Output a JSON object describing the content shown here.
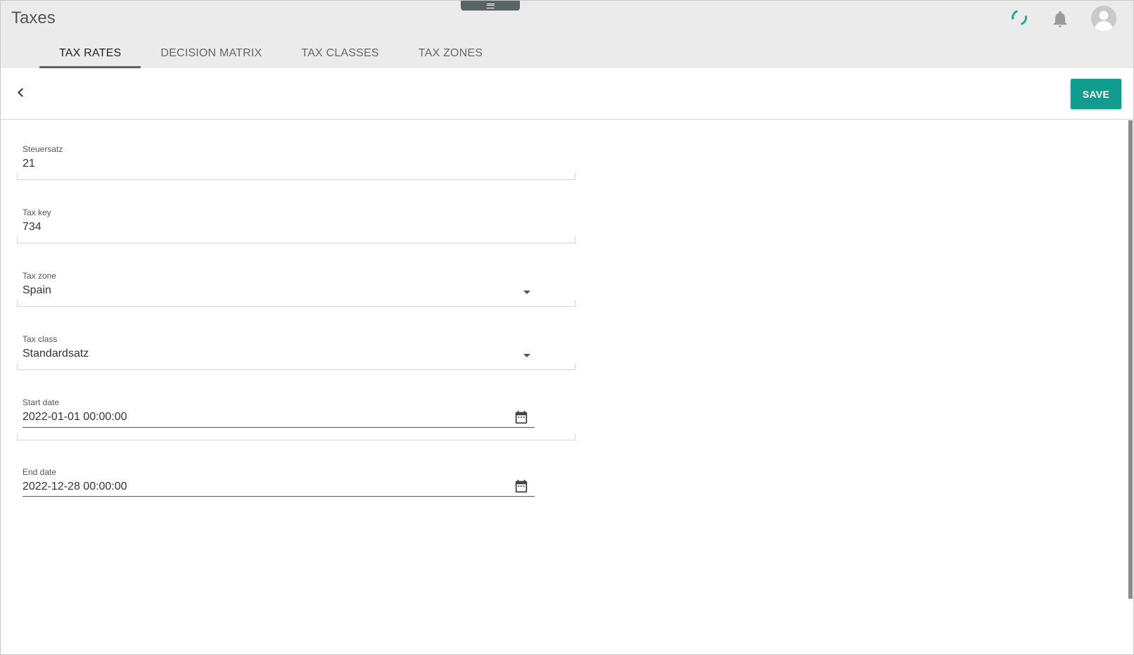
{
  "header": {
    "title": "Taxes",
    "tabs": [
      {
        "label": "TAX RATES",
        "active": true
      },
      {
        "label": "DECISION MATRIX",
        "active": false
      },
      {
        "label": "TAX CLASSES",
        "active": false
      },
      {
        "label": "TAX ZONES",
        "active": false
      }
    ],
    "icons": {
      "spinner": "loading-spinner-icon",
      "notifications": "bell-icon",
      "user": "avatar-icon"
    }
  },
  "toolbar": {
    "save_label": "SAVE",
    "back_icon": "chevron-left-icon"
  },
  "form": {
    "tax_rate": {
      "label": "Steuersatz",
      "value": "21"
    },
    "tax_key": {
      "label": "Tax key",
      "value": "734"
    },
    "tax_zone": {
      "label": "Tax zone",
      "value": "Spain"
    },
    "tax_class": {
      "label": "Tax class",
      "value": "Standardsatz"
    },
    "start_date": {
      "label": "Start date",
      "value": "2022-01-01 00:00:00"
    },
    "end_date": {
      "label": "End date",
      "value": "2022-12-28 00:00:00"
    }
  },
  "colors": {
    "accent": "#109d8f",
    "spinner": "#1aa99b",
    "header_bg": "#ebebeb",
    "tab_indicator": "#5a6366"
  }
}
